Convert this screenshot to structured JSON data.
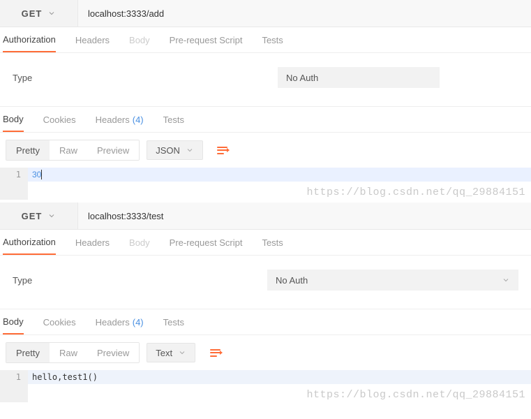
{
  "request1": {
    "method": "GET",
    "url": "localhost:3333/add",
    "tabs": {
      "auth": "Authorization",
      "headers": "Headers",
      "body": "Body",
      "prereq": "Pre-request Script",
      "tests": "Tests"
    },
    "auth": {
      "type_label": "Type",
      "selected": "No Auth"
    },
    "response_tabs": {
      "body": "Body",
      "cookies": "Cookies",
      "headers": "Headers",
      "headers_count": "(4)",
      "tests": "Tests"
    },
    "format": {
      "pretty": "Pretty",
      "raw": "Raw",
      "preview": "Preview",
      "lang": "JSON"
    },
    "code": {
      "line_no": "1",
      "text": "30"
    }
  },
  "request2": {
    "method": "GET",
    "url": "localhost:3333/test",
    "tabs": {
      "auth": "Authorization",
      "headers": "Headers",
      "body": "Body",
      "prereq": "Pre-request Script",
      "tests": "Tests"
    },
    "auth": {
      "type_label": "Type",
      "selected": "No Auth"
    },
    "response_tabs": {
      "body": "Body",
      "cookies": "Cookies",
      "headers": "Headers",
      "headers_count": "(4)",
      "tests": "Tests"
    },
    "format": {
      "pretty": "Pretty",
      "raw": "Raw",
      "preview": "Preview",
      "lang": "Text"
    },
    "code": {
      "line_no": "1",
      "text": "hello,test1()"
    }
  },
  "watermark": "https://blog.csdn.net/qq_29884151"
}
